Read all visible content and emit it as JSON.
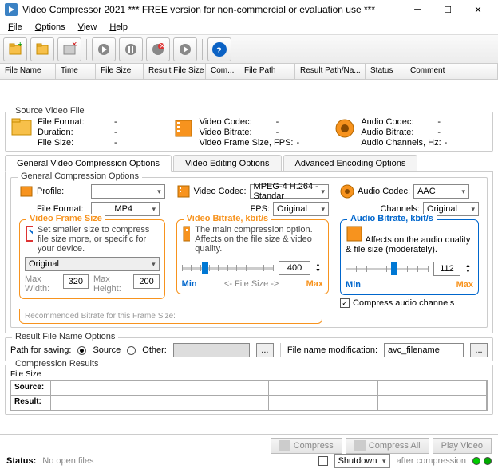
{
  "title": "Video Compressor 2021    *** FREE version for non-commercial or evaluation use ***",
  "menus": {
    "file": "File",
    "options": "Options",
    "view": "View",
    "help": "Help"
  },
  "list_columns": [
    "File Name",
    "Time",
    "File Size",
    "Result File Size",
    "Com...",
    "File Path",
    "Result Path/Na...",
    "Status",
    "Comment"
  ],
  "source": {
    "legend": "Source Video File",
    "block1": {
      "file_format": "File Format:",
      "duration": "Duration:",
      "file_size": "File Size:",
      "v1": "-",
      "v2": "-",
      "v3": "-"
    },
    "block2": {
      "video_codec": "Video Codec:",
      "video_bitrate": "Video Bitrate:",
      "video_frame": "Video Frame Size, FPS:",
      "v1": "-",
      "v2": "-",
      "v3": "-"
    },
    "block3": {
      "audio_codec": "Audio Codec:",
      "audio_bitrate": "Audio Bitrate:",
      "audio_channels": "Audio Channels, Hz:",
      "v1": "-",
      "v2": "-",
      "v3": "-"
    }
  },
  "tabs": {
    "general": "General Video Compression Options",
    "editing": "Video Editing Options",
    "advanced": "Advanced Encoding Options"
  },
  "gco": {
    "legend": "General Compression Options",
    "profile_label": "Profile:",
    "profile_val": "",
    "file_format_label": "File Format:",
    "file_format_val": "MP4",
    "video_codec_label": "Video Codec:",
    "video_codec_val": "MPEG-4 H.264 - Standar",
    "fps_label": "FPS:",
    "fps_val": "Original",
    "audio_codec_label": "Audio Codec:",
    "audio_codec_val": "AAC",
    "channels_label": "Channels:",
    "channels_val": "Original",
    "frame_size": {
      "legend": "Video Frame Size",
      "hint": "Set smaller size to compress file size more, or specific for your device.",
      "preset": "Original",
      "max_width_label": "Max Width:",
      "max_width_val": "320",
      "max_height_label": "Max Height:",
      "max_height_val": "200"
    },
    "bitrate": {
      "legend": "Video Bitrate, kbit/s",
      "hint": "The main compression option. Affects on the file size & video quality.",
      "value": "400",
      "min": "Min",
      "max": "Max",
      "mid": "<-  File Size  ->"
    },
    "audio_bitrate": {
      "legend": "Audio Bitrate, kbit/s",
      "hint": "Affects on the audio quality & file size (moderately).",
      "value": "112",
      "min": "Min",
      "max": "Max"
    },
    "compress_audio": "Compress audio channels",
    "recommend": "Recommended Bitrate for this Frame Size:"
  },
  "result_file": {
    "legend": "Result File Name Options",
    "path_label": "Path for saving:",
    "source": "Source",
    "other": "Other:",
    "mod_label": "File name modification:",
    "mod_val": "avc_filename"
  },
  "results": {
    "legend": "Compression Results",
    "filesize": "File Size",
    "source": "Source:",
    "result": "Result:"
  },
  "status": {
    "label": "Status:",
    "value": "No open files"
  },
  "buttons": {
    "compress": "Compress",
    "compress_all": "Compress All",
    "play": "Play Video",
    "shutdown": "Shutdown",
    "after": "after compression"
  }
}
